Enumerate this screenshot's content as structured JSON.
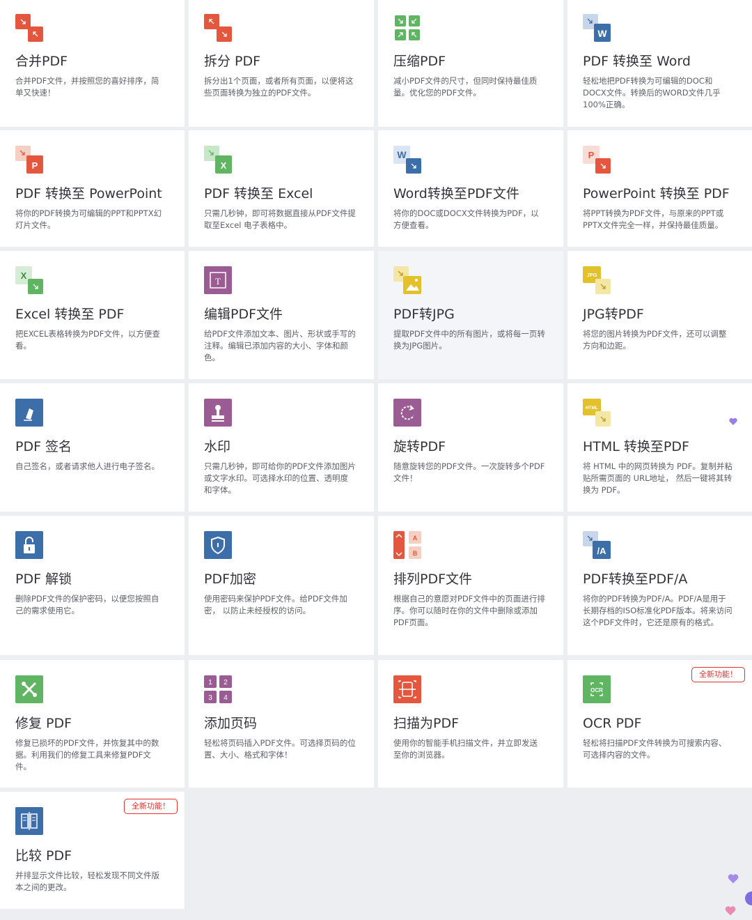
{
  "tools": [
    {
      "id": "merge",
      "icon": "merge-pdf-icon",
      "title": "合并PDF",
      "desc": "合并PDF文件，并按照您的喜好排序，简单又快速！"
    },
    {
      "id": "split",
      "icon": "split-pdf-icon",
      "title": "拆分 PDF",
      "desc": "拆分出1个页面，或者所有页面，以便将这些页面转换为独立的PDF文件。"
    },
    {
      "id": "compress",
      "icon": "compress-pdf-icon",
      "title": "压缩PDF",
      "desc": "减小PDF文件的尺寸，但同时保持最佳质量。优化您的PDF文件。"
    },
    {
      "id": "pdf2word",
      "icon": "pdf-to-word-icon",
      "title": "PDF 转换至 Word",
      "desc": "轻松地把PDF转换为可编辑的DOC和DOCX文件。转换后的WORD文件几乎100%正确。"
    },
    {
      "id": "pdf2ppt",
      "icon": "pdf-to-powerpoint-icon",
      "title": "PDF 转换至 PowerPoint",
      "desc": "将你的PDF转换为可编辑的PPT和PPTX幻灯片文件。"
    },
    {
      "id": "pdf2excel",
      "icon": "pdf-to-excel-icon",
      "title": "PDF 转换至 Excel",
      "desc": "只需几秒钟，即可将数据直接从PDF文件提取至Excel 电子表格中。"
    },
    {
      "id": "word2pdf",
      "icon": "word-to-pdf-icon",
      "title": "Word转换至PDF文件",
      "desc": "将你的DOC或DOCX文件转换为PDF，以方便查看。"
    },
    {
      "id": "ppt2pdf",
      "icon": "powerpoint-to-pdf-icon",
      "title": "PowerPoint 转换至 PDF",
      "desc": "将PPT转换为PDF文件，与原来的PPT或PPTX文件完全一样，并保持最佳质量。"
    },
    {
      "id": "excel2pdf",
      "icon": "excel-to-pdf-icon",
      "title": "Excel 转换至 PDF",
      "desc": "把EXCEL表格转换为PDF文件，以方便查看。"
    },
    {
      "id": "edit",
      "icon": "edit-pdf-icon",
      "title": "编辑PDF文件",
      "desc": "给PDF文件添加文本、图片、形状或手写的注释。编辑已添加内容的大小、字体和颜色。"
    },
    {
      "id": "pdf2jpg",
      "icon": "pdf-to-jpg-icon",
      "title": "PDF转JPG",
      "desc": "提取PDF文件中的所有图片，或将每一页转换为JPG图片。"
    },
    {
      "id": "jpg2pdf",
      "icon": "jpg-to-pdf-icon",
      "title": "JPG转PDF",
      "desc": "将您的图片转换为PDF文件，还可以调整方向和边距。"
    },
    {
      "id": "sign",
      "icon": "sign-pdf-icon",
      "title": "PDF 签名",
      "desc": "自己签名，或者请求他人进行电子签名。"
    },
    {
      "id": "watermark",
      "icon": "watermark-icon",
      "title": "水印",
      "desc": "只需几秒钟，即可给你的PDF文件添加图片或文字水印。可选择水印的位置、透明度和字体。"
    },
    {
      "id": "rotate",
      "icon": "rotate-pdf-icon",
      "title": "旋转PDF",
      "desc": "随意旋转您的PDF文件。一次旋转多个PDF文件！"
    },
    {
      "id": "html2pdf",
      "icon": "html-to-pdf-icon",
      "title": "HTML 转换至PDF",
      "desc": "将 HTML 中的网页转换为 PDF。复制并粘贴所需页面的 URL地址， 然后一键将其转换为 PDF。"
    },
    {
      "id": "unlock",
      "icon": "unlock-pdf-icon",
      "title": "PDF 解锁",
      "desc": "删除PDF文件的保护密码，以便您按照自己的需求使用它。"
    },
    {
      "id": "protect",
      "icon": "protect-pdf-icon",
      "title": "PDF加密",
      "desc": "使用密码来保护PDF文件。给PDF文件加密， 以防止未经授权的访问。"
    },
    {
      "id": "organize",
      "icon": "organize-pdf-icon",
      "title": "排列PDF文件",
      "desc": "根据自己的意愿对PDF文件中的页面进行排序。你可以随时在你的文件中删除或添加PDF页面。"
    },
    {
      "id": "pdfa",
      "icon": "pdf-to-pdfa-icon",
      "title": "PDF转换至PDF/A",
      "desc": "将你的PDF转换为PDF/A。PDF/A是用于长期存档的ISO标准化PDF版本。将来访问这个PDF文件时，它还是原有的格式。"
    },
    {
      "id": "repair",
      "icon": "repair-pdf-icon",
      "title": "修复 PDF",
      "desc": "修复已损坏的PDF文件，并恢复其中的数据。利用我们的修复工具来修复PDF文件。"
    },
    {
      "id": "pagenum",
      "icon": "page-numbers-icon",
      "title": "添加页码",
      "desc": "轻松将页码插入PDF文件。可选择页码的位置、大小、格式和字体！"
    },
    {
      "id": "scan",
      "icon": "scan-to-pdf-icon",
      "title": "扫描为PDF",
      "desc": "使用你的智能手机扫描文件，并立即发送至你的浏览器。"
    },
    {
      "id": "ocr",
      "icon": "ocr-pdf-icon",
      "title": "OCR PDF",
      "desc": "轻松将扫描PDF文件转换为可搜索内容、可选择内容的文件。",
      "badge": "全新功能！"
    },
    {
      "id": "compare",
      "icon": "compare-pdf-icon",
      "title": "比较 PDF",
      "desc": "并排显示文件比较，轻松发现不同文件版本之间的更改。",
      "badge": "全新功能！"
    }
  ],
  "colors": {
    "red": "#e5563f",
    "green": "#5fb562",
    "blue": "#3c6ea9",
    "purple": "#9a5c92",
    "yellow": "#e2c12b",
    "pink": "#eba18f",
    "badge": "#e5322d"
  }
}
